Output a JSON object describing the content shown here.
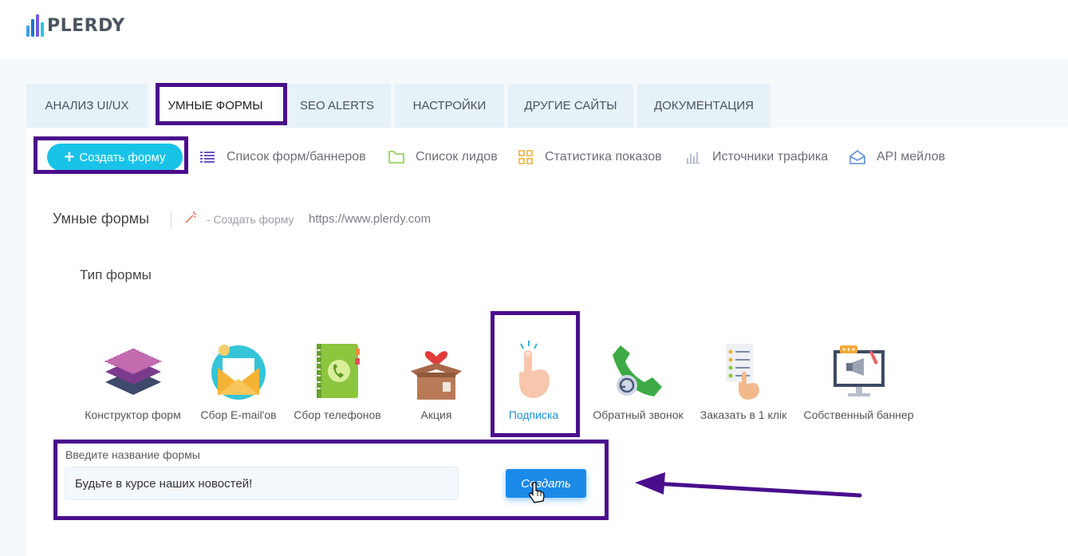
{
  "header": {
    "logo_text": "PLERDY",
    "logo_bar_colors": [
      "#3aa0e8",
      "#1f74d2",
      "#7a5ad8",
      "#2ac7e0"
    ]
  },
  "tabs": [
    {
      "label": "АНАЛИЗ UI/UX",
      "active": false
    },
    {
      "label": "УМНЫЕ ФОРМЫ",
      "active": true
    },
    {
      "label": "SEO ALERTS",
      "active": false
    },
    {
      "label": "НАСТРОЙКИ",
      "active": false
    },
    {
      "label": "ДРУГИЕ САЙТЫ",
      "active": false
    },
    {
      "label": "ДОКУМЕНТАЦИЯ",
      "active": false
    }
  ],
  "toolbar": {
    "create_label": "Создать форму",
    "links": [
      {
        "label": "Список форм/баннеров",
        "icon": "list-icon"
      },
      {
        "label": "Список лидов",
        "icon": "folder-icon"
      },
      {
        "label": "Статистика показов",
        "icon": "grid-icon"
      },
      {
        "label": "Источники трафика",
        "icon": "bar-chart-icon"
      },
      {
        "label": "API мейлов",
        "icon": "envelope-icon"
      }
    ]
  },
  "breadcrumb": {
    "title": "Умные формы",
    "action": "- Создать форму",
    "url": "https://www.plerdy.com"
  },
  "form_types": {
    "heading": "Тип формы",
    "items": [
      {
        "label": "Конструктор форм",
        "icon": "layers-icon"
      },
      {
        "label": "Сбор E-mail'ов",
        "icon": "envelope-open-icon"
      },
      {
        "label": "Сбор телефонов",
        "icon": "phonebook-icon"
      },
      {
        "label": "Акция",
        "icon": "gift-box-icon"
      },
      {
        "label": "Подписка",
        "icon": "tap-finger-icon",
        "selected": true
      },
      {
        "label": "Обратный звонок",
        "icon": "phone-callback-icon"
      },
      {
        "label": "Заказать в 1 клік",
        "icon": "click-list-icon"
      },
      {
        "label": "Собственный баннер",
        "icon": "banner-icon"
      }
    ]
  },
  "name_form": {
    "label": "Введите название формы",
    "value": "Будьте в курсе наших новостей!",
    "submit_label": "Создать"
  },
  "colors": {
    "accent": "#19c3e8",
    "primary_button": "#1b8ae8",
    "highlight": "#4a0e8c"
  }
}
